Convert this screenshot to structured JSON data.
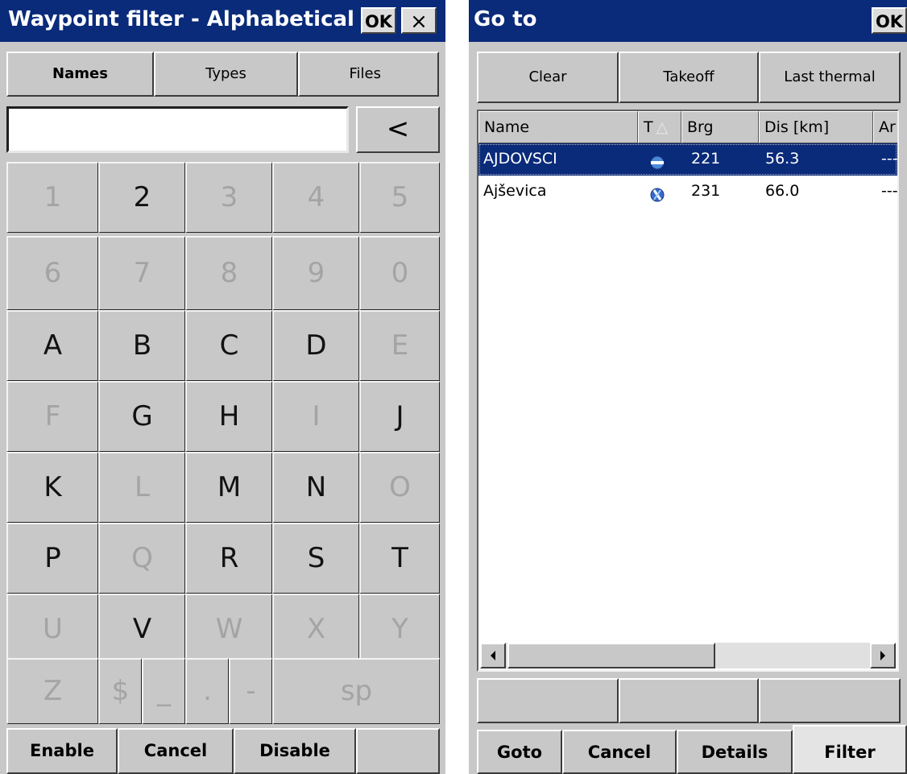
{
  "left": {
    "title": "Waypoint filter - Alphabetical",
    "ok": "OK",
    "close": "×",
    "tabs": [
      "Names",
      "Types",
      "Files"
    ],
    "input_value": "",
    "backspace": "<",
    "keys": [
      [
        {
          "label": "1",
          "enabled": false
        },
        {
          "label": "2",
          "enabled": true
        },
        {
          "label": "3",
          "enabled": false
        },
        {
          "label": "4",
          "enabled": false
        },
        {
          "label": "5",
          "enabled": false
        }
      ],
      [
        {
          "label": "6",
          "enabled": false
        },
        {
          "label": "7",
          "enabled": false
        },
        {
          "label": "8",
          "enabled": false
        },
        {
          "label": "9",
          "enabled": false
        },
        {
          "label": "0",
          "enabled": false
        }
      ],
      [
        {
          "label": "A",
          "enabled": true
        },
        {
          "label": "B",
          "enabled": true
        },
        {
          "label": "C",
          "enabled": true
        },
        {
          "label": "D",
          "enabled": true
        },
        {
          "label": "E",
          "enabled": false
        }
      ],
      [
        {
          "label": "F",
          "enabled": false
        },
        {
          "label": "G",
          "enabled": true
        },
        {
          "label": "H",
          "enabled": true
        },
        {
          "label": "I",
          "enabled": false
        },
        {
          "label": "J",
          "enabled": true
        }
      ],
      [
        {
          "label": "K",
          "enabled": true
        },
        {
          "label": "L",
          "enabled": false
        },
        {
          "label": "M",
          "enabled": true
        },
        {
          "label": "N",
          "enabled": true
        },
        {
          "label": "O",
          "enabled": false
        }
      ],
      [
        {
          "label": "P",
          "enabled": true
        },
        {
          "label": "Q",
          "enabled": false
        },
        {
          "label": "R",
          "enabled": true
        },
        {
          "label": "S",
          "enabled": true
        },
        {
          "label": "T",
          "enabled": true
        }
      ],
      [
        {
          "label": "U",
          "enabled": false
        },
        {
          "label": "V",
          "enabled": true
        },
        {
          "label": "W",
          "enabled": false
        },
        {
          "label": "X",
          "enabled": false
        },
        {
          "label": "Y",
          "enabled": false
        }
      ]
    ],
    "last_row": [
      {
        "label": "Z",
        "enabled": false
      },
      {
        "label": "$",
        "enabled": false
      },
      {
        "label": "_",
        "enabled": false
      },
      {
        "label": ".",
        "enabled": false
      },
      {
        "label": "-",
        "enabled": false
      },
      {
        "label": "sp",
        "enabled": false
      }
    ],
    "bottom": [
      "Enable",
      "Cancel",
      "Disable",
      ""
    ]
  },
  "right": {
    "title": "Go to",
    "ok": "OK",
    "top_buttons": [
      "Clear",
      "Takeoff",
      "Last thermal"
    ],
    "columns": [
      "Name",
      "T",
      "Brg",
      "Dis [km]",
      "Ar"
    ],
    "sort_indicator": "△",
    "rows": [
      {
        "name": "AJDOVSCI",
        "type_icon": "airfield-icon",
        "brg": "221",
        "dis": "56.3",
        "ar": "---",
        "selected": true
      },
      {
        "name": "Ajševica",
        "type_icon": "landing-field-icon",
        "brg": "231",
        "dis": "66.0",
        "ar": "---",
        "selected": false
      }
    ],
    "middle_buttons": [
      "",
      "",
      ""
    ],
    "bottom": [
      "Goto",
      "Cancel",
      "Details",
      "Filter"
    ]
  }
}
